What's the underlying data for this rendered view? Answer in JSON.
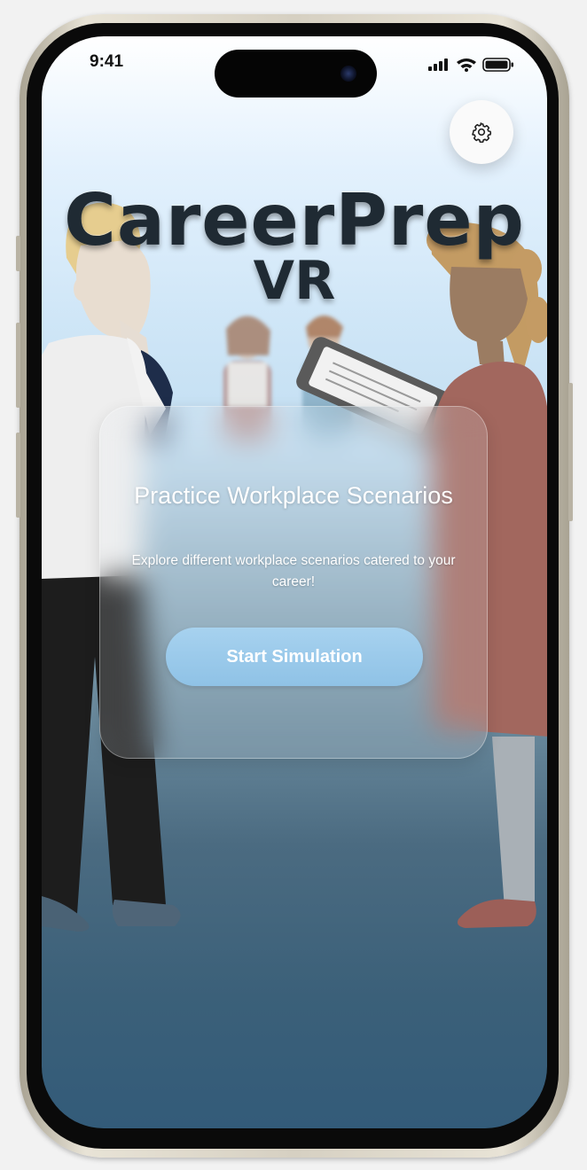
{
  "status_bar": {
    "time": "9:41"
  },
  "app": {
    "title": "CareerPrep",
    "subtitle": "VR"
  },
  "header": {
    "settings_icon": "gear-icon"
  },
  "card": {
    "title": "Practice Workplace Scenarios",
    "description": "Explore different workplace scenarios catered to your career!",
    "button_label": "Start Simulation"
  },
  "colors": {
    "button": "#9ccbec",
    "title_text": "#1f2a33",
    "background_bottom": "#335b79"
  }
}
